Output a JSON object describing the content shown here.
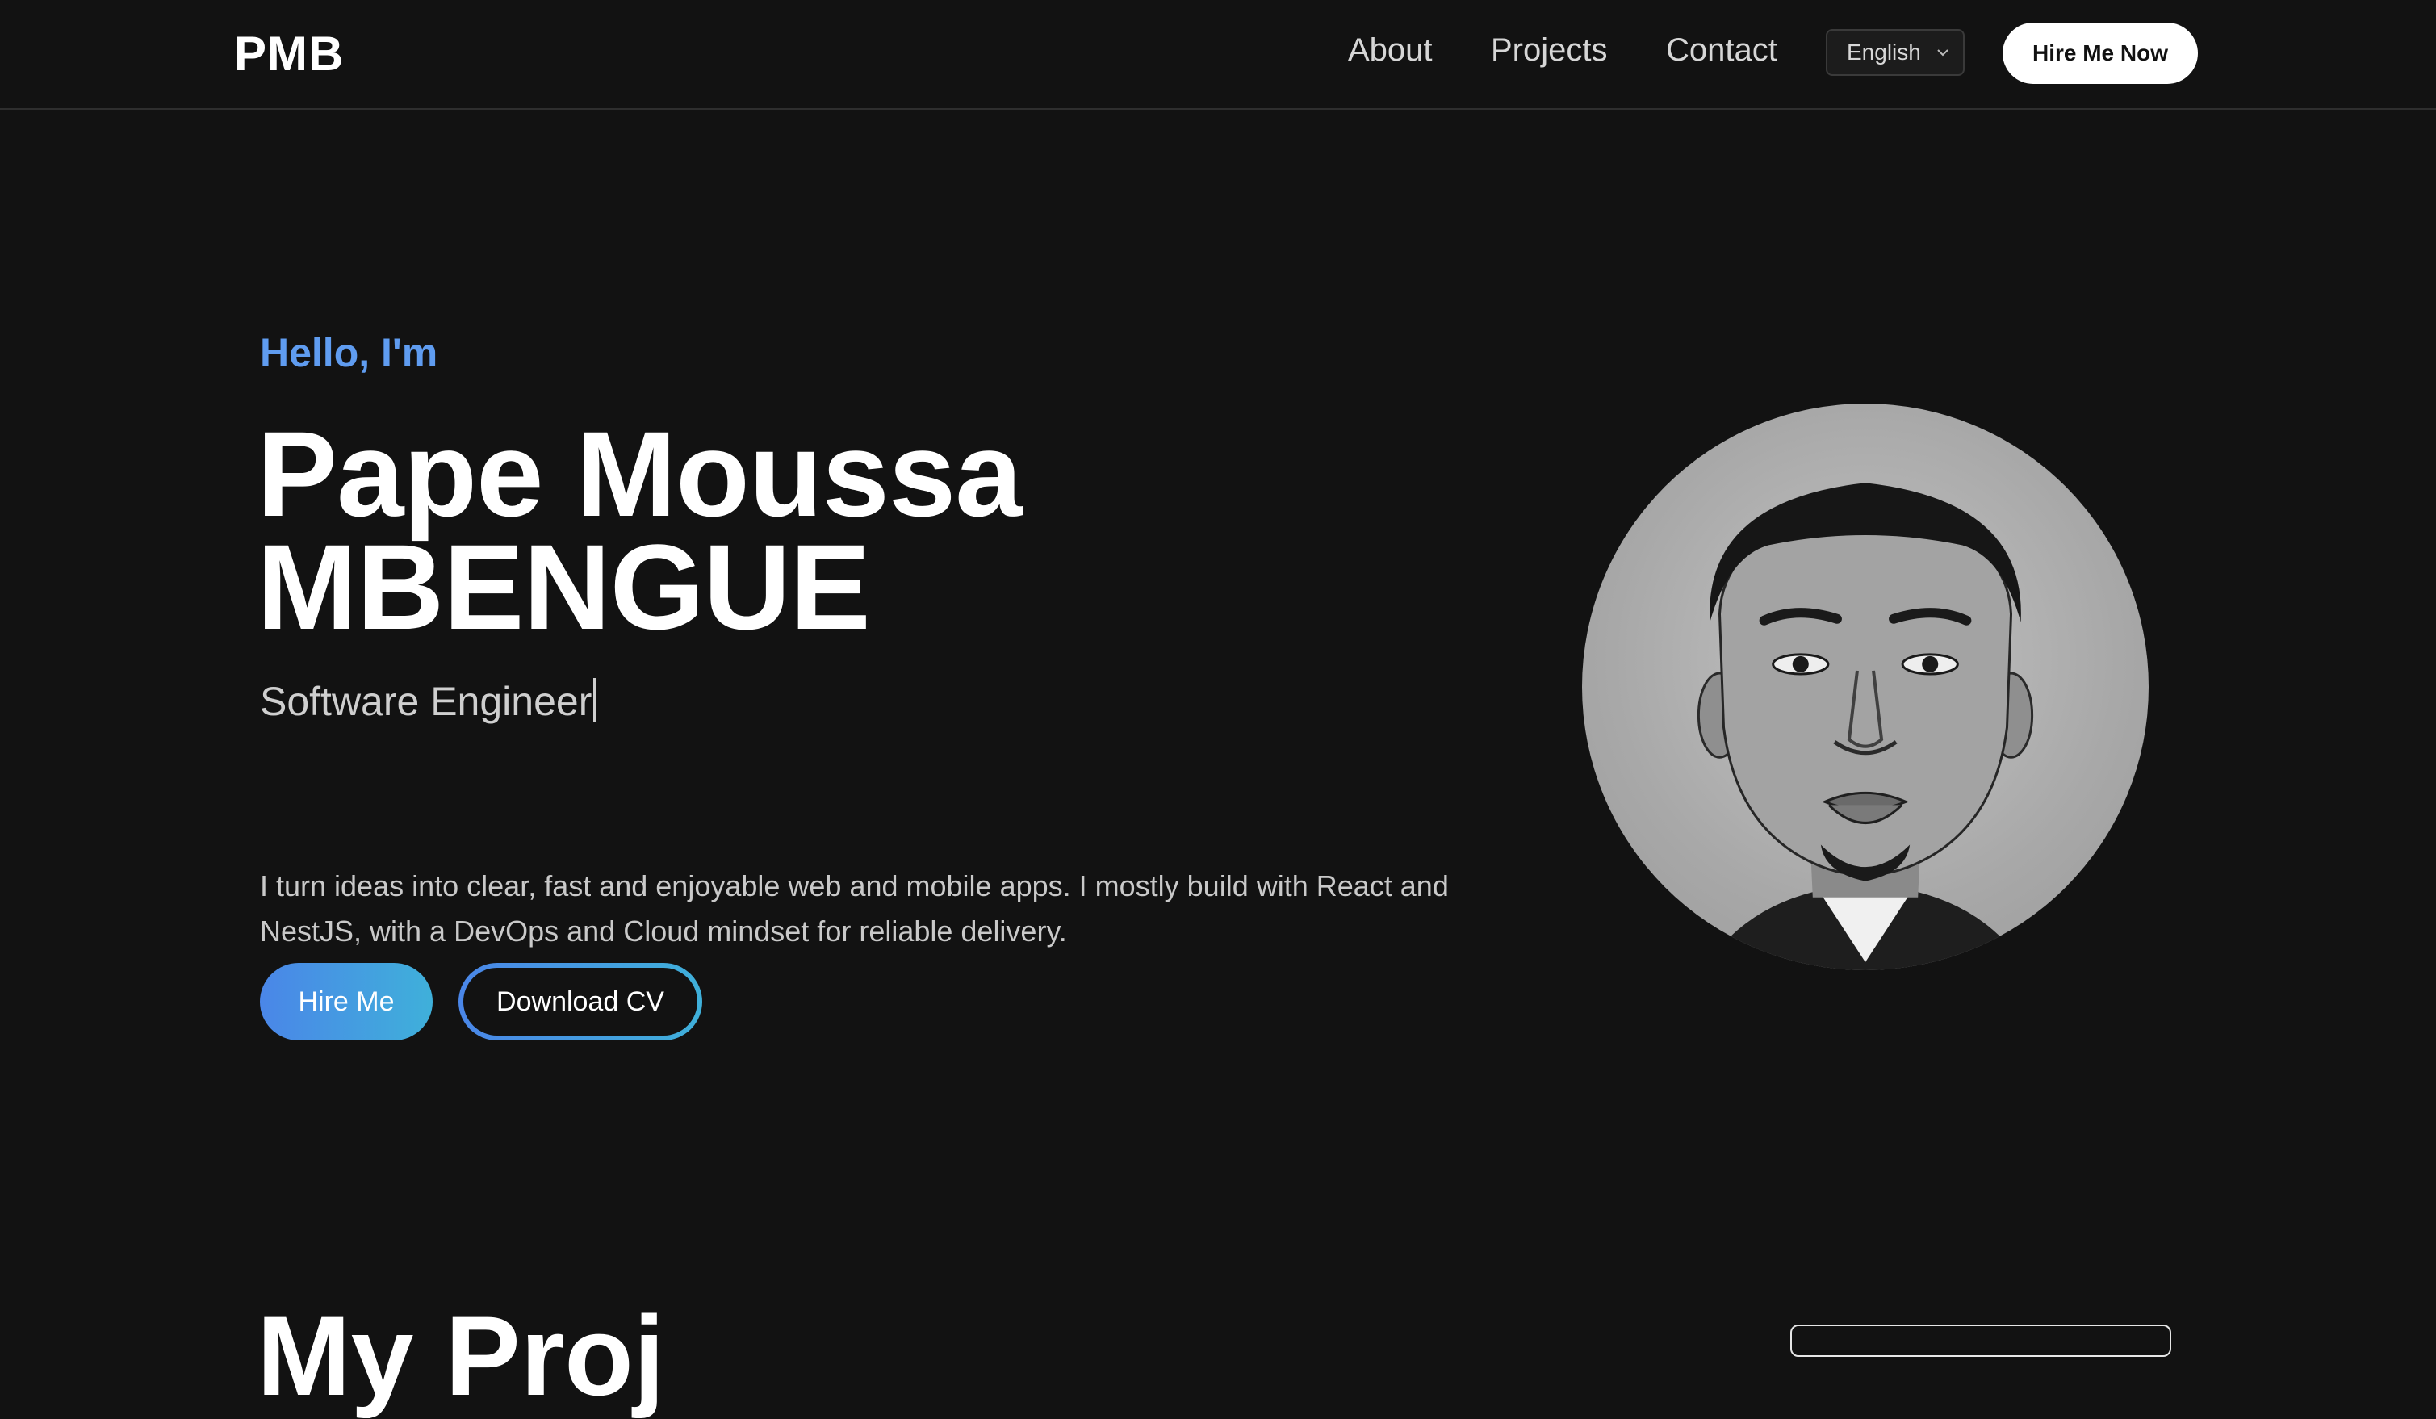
{
  "header": {
    "logo": "PMB",
    "nav": {
      "about": "About",
      "projects": "Projects",
      "contact": "Contact"
    },
    "language": {
      "selected": "English"
    },
    "cta": "Hire Me Now"
  },
  "hero": {
    "greeting": "Hello, I'm",
    "name_first": "Pape Moussa",
    "name_last": "MBENGUE",
    "role": "Software Engineer",
    "bio": "I turn ideas into clear, fast and enjoyable web and mobile apps. I mostly build with React and NestJS, with a DevOps and Cloud mindset for reliable delivery.",
    "buttons": {
      "hire": "Hire Me",
      "download_cv": "Download CV"
    }
  },
  "next_section": {
    "title_peek": "My Proj"
  },
  "colors": {
    "background": "#121212",
    "accent_blue": "#5f9cf0",
    "gradient_start": "#4a86e8",
    "gradient_end": "#3fb0da"
  },
  "icons": {
    "language_dropdown": "chevron-down-icon",
    "portrait": "avatar"
  }
}
